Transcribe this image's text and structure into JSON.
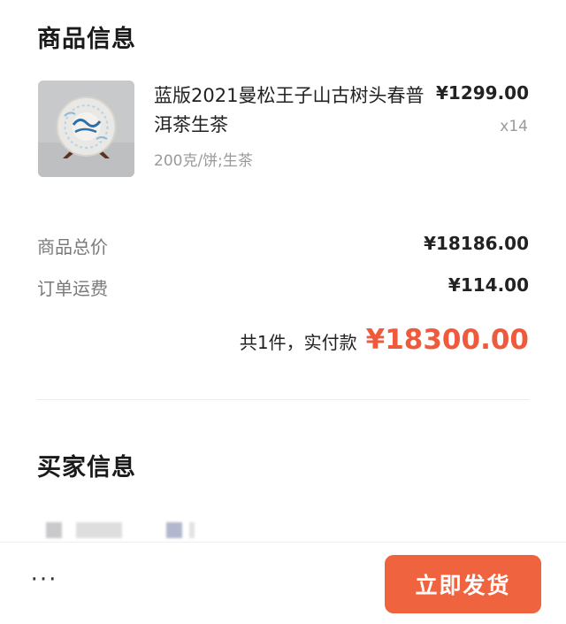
{
  "goods_section": {
    "title": "商品信息"
  },
  "product": {
    "image_icon": "pu-erh-tea-cake-image",
    "name": "蓝版2021曼松王子山古树头春普洱茶生茶",
    "spec": "200克/饼;生茶",
    "price": "¥1299.00",
    "quantity": "x14"
  },
  "summary": {
    "subtotal_label": "商品总价",
    "subtotal_value": "¥18186.00",
    "shipping_label": "订单运费",
    "shipping_value": "¥114.00",
    "total_prefix": "共1件，实付款",
    "total_amount": "¥18300.00"
  },
  "buyer_section": {
    "title": "买家信息"
  },
  "bottom_bar": {
    "more_label": "···",
    "ship_label": "立即发货"
  },
  "colors": {
    "accent": "#ee5a3b",
    "button": "#f0633f",
    "muted_text": "#9a9a9a"
  }
}
